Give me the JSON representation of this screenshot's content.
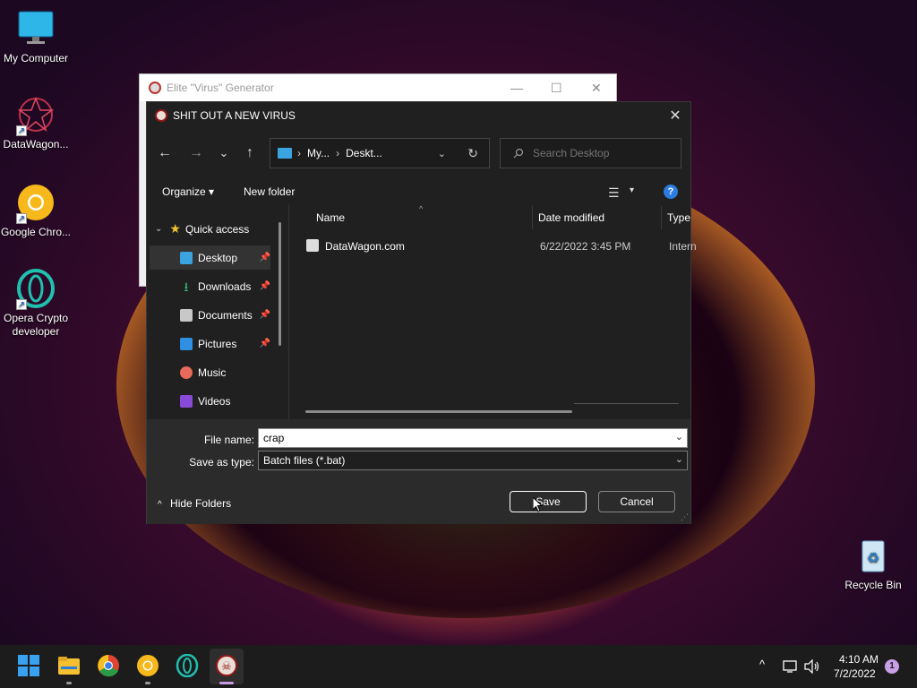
{
  "desktop": {
    "icons": [
      {
        "label": "My Computer"
      },
      {
        "label": "DataWagon..."
      },
      {
        "label": "Google Chro..."
      },
      {
        "label": "Opera Crypto developer"
      },
      {
        "label": "Recycle Bin"
      }
    ]
  },
  "background_window": {
    "title": "Elite \"Virus\" Generator",
    "minimize": "—",
    "maximize": "☐",
    "close": "✕"
  },
  "dialog": {
    "title": "SHIT OUT A NEW VIRUS",
    "close": "✕",
    "nav": {
      "back": "←",
      "forward": "→",
      "recent": "⌄",
      "up": "↑"
    },
    "address": {
      "segments": [
        "My...",
        "Deskt..."
      ],
      "separator": "›",
      "dropdown": "⌄",
      "refresh": "↻"
    },
    "search": {
      "placeholder": "Search Desktop"
    },
    "toolbar": {
      "organize": "Organize ▾",
      "new_folder": "New folder",
      "view_dd": "▾",
      "help": "?"
    },
    "nav_pane": {
      "quick_access": "Quick access",
      "items": [
        {
          "label": "Desktop",
          "pinned": true
        },
        {
          "label": "Downloads",
          "pinned": true
        },
        {
          "label": "Documents",
          "pinned": true
        },
        {
          "label": "Pictures",
          "pinned": true
        },
        {
          "label": "Music",
          "pinned": false
        },
        {
          "label": "Videos",
          "pinned": false
        }
      ]
    },
    "columns": {
      "name": "Name",
      "date_modified": "Date modified",
      "type": "Type"
    },
    "files": [
      {
        "name": "DataWagon.com",
        "date_modified": "6/22/2022 3:45 PM",
        "type": "Intern"
      }
    ],
    "file_name": {
      "label": "File name:",
      "value": "crap"
    },
    "save_as_type": {
      "label": "Save as type:",
      "value": "Batch files (*.bat)"
    },
    "hide_folders": "Hide Folders",
    "save_button": "Save",
    "cancel_button": "Cancel"
  },
  "taskbar": {
    "time": "4:10 AM",
    "date": "7/2/2022",
    "notification_count": "1",
    "tray_chevron": "^"
  }
}
